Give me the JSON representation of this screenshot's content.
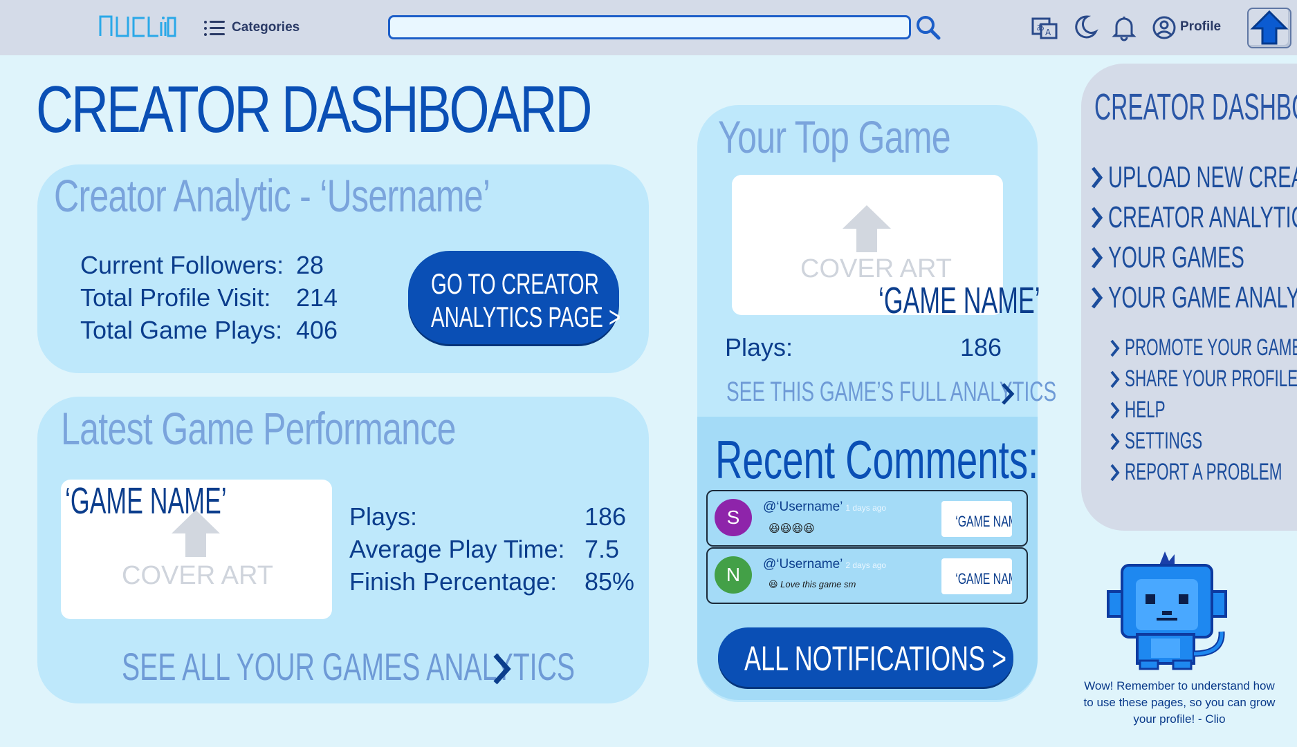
{
  "topbar": {
    "logo_text": "nucliio",
    "categories_label": "Categories",
    "search_value": "",
    "search_placeholder": "",
    "profile_label": "Profile",
    "icons": [
      "translate-icon",
      "moon-icon",
      "bell-icon",
      "user-circle-icon",
      "upload-arrow-icon"
    ]
  },
  "page_title": "CREATOR DASHBOARD",
  "analytics_card": {
    "title": "Creator Analytic - ‘Username’",
    "stats": [
      {
        "label": "Current Followers:",
        "value": "28"
      },
      {
        "label": "Total Profile Visit:",
        "value": "214"
      },
      {
        "label": "Total Game Plays:",
        "value": "406"
      }
    ],
    "button_line1": "GO TO CREATOR",
    "button_line2": "ANALYTICS PAGE >"
  },
  "latest_card": {
    "title": "Latest Game Performance",
    "game_name": "‘GAME NAME’",
    "cover_text": "COVER ART",
    "stats": [
      {
        "label": "Plays:",
        "value": "186"
      },
      {
        "label": "Average Play Time:",
        "value": "7.5"
      },
      {
        "label": "Finish Percentage:",
        "value": "85%"
      }
    ],
    "link": "SEE ALL YOUR GAMES ANALYTICS"
  },
  "top_game_card": {
    "title": "Your Top Game",
    "cover_text": "COVER ART",
    "game_name": "‘GAME NAME’",
    "plays_label": "Plays:",
    "plays_value": "186",
    "link": "SEE THIS GAME’S FULL ANALYTICS"
  },
  "comments": {
    "title": "Recent Comments:",
    "items": [
      {
        "initial": "S",
        "avatar_color": "#8e24aa",
        "user": "@‘Username’",
        "time": "1 days ago",
        "body": "😆😆😆😆",
        "game": "‘GAME NAME’"
      },
      {
        "initial": "N",
        "avatar_color": "#43a047",
        "user": "@‘Username’",
        "time": "2 days ago",
        "body": "😆 Love this game sm",
        "game": "‘GAME NAME’"
      }
    ],
    "button": "ALL NOTIFICATIONS >"
  },
  "sidebar": {
    "title": "CREATOR DASHBOARD",
    "main_items": [
      "UPLOAD NEW CREATION",
      "CREATOR ANALYTICS",
      "YOUR GAMES",
      "YOUR GAME ANALYTICS"
    ],
    "sub_items": [
      "PROMOTE YOUR GAME",
      "SHARE YOUR PROFILE",
      "HELP",
      "SETTINGS",
      "REPORT A PROBLEM"
    ]
  },
  "mascot": {
    "message": "Wow!  Remember to understand how to use these pages, so you can grow your profile!  - Clio"
  },
  "colors": {
    "background": "#dff4fb",
    "card": "#bee8fb",
    "primary": "#0a4fb5",
    "topbar": "#d4dbe8"
  }
}
